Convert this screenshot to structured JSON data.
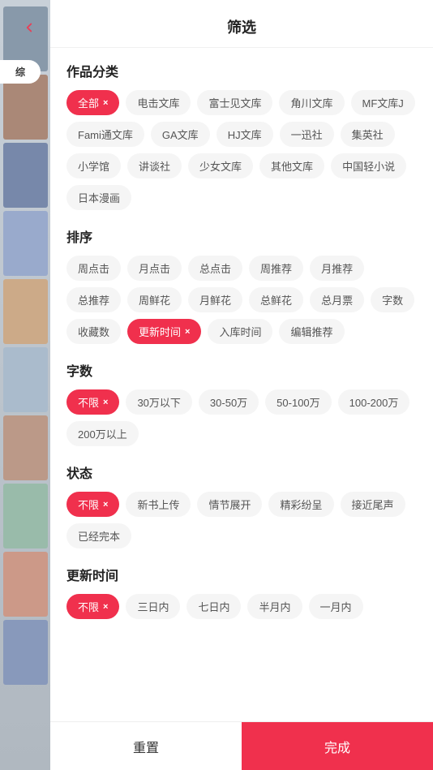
{
  "header": {
    "title": "筛选",
    "back_label": "back"
  },
  "sections": {
    "category": {
      "title": "作品分类",
      "tags": [
        {
          "label": "全部",
          "active": true
        },
        {
          "label": "电击文库",
          "active": false
        },
        {
          "label": "富士见文库",
          "active": false
        },
        {
          "label": "角川文库",
          "active": false
        },
        {
          "label": "MF文库J",
          "active": false
        },
        {
          "label": "Fami通文库",
          "active": false
        },
        {
          "label": "GA文库",
          "active": false
        },
        {
          "label": "HJ文库",
          "active": false
        },
        {
          "label": "一迅社",
          "active": false
        },
        {
          "label": "集英社",
          "active": false
        },
        {
          "label": "小学馆",
          "active": false
        },
        {
          "label": "讲谈社",
          "active": false
        },
        {
          "label": "少女文库",
          "active": false
        },
        {
          "label": "其他文库",
          "active": false
        },
        {
          "label": "中国轻小说",
          "active": false
        },
        {
          "label": "日本漫画",
          "active": false
        }
      ]
    },
    "sort": {
      "title": "排序",
      "tags": [
        {
          "label": "周点击",
          "active": false
        },
        {
          "label": "月点击",
          "active": false
        },
        {
          "label": "总点击",
          "active": false
        },
        {
          "label": "周推荐",
          "active": false
        },
        {
          "label": "月推荐",
          "active": false
        },
        {
          "label": "总推荐",
          "active": false
        },
        {
          "label": "周鲜花",
          "active": false
        },
        {
          "label": "月鲜花",
          "active": false
        },
        {
          "label": "总鲜花",
          "active": false
        },
        {
          "label": "总月票",
          "active": false
        },
        {
          "label": "字数",
          "active": false
        },
        {
          "label": "收藏数",
          "active": false
        },
        {
          "label": "更新时间",
          "active": true
        },
        {
          "label": "入库时间",
          "active": false
        },
        {
          "label": "编辑推荐",
          "active": false
        }
      ]
    },
    "word_count": {
      "title": "字数",
      "tags": [
        {
          "label": "不限",
          "active": true
        },
        {
          "label": "30万以下",
          "active": false
        },
        {
          "label": "30-50万",
          "active": false
        },
        {
          "label": "50-100万",
          "active": false
        },
        {
          "label": "100-200万",
          "active": false
        },
        {
          "label": "200万以上",
          "active": false
        }
      ]
    },
    "status": {
      "title": "状态",
      "tags": [
        {
          "label": "不限",
          "active": true
        },
        {
          "label": "新书上传",
          "active": false
        },
        {
          "label": "情节展开",
          "active": false
        },
        {
          "label": "精彩纷呈",
          "active": false
        },
        {
          "label": "接近尾声",
          "active": false
        },
        {
          "label": "已经完本",
          "active": false
        }
      ]
    },
    "update_time": {
      "title": "更新时间",
      "tags": [
        {
          "label": "不限",
          "active": true
        },
        {
          "label": "三日内",
          "active": false
        },
        {
          "label": "七日内",
          "active": false
        },
        {
          "label": "半月内",
          "active": false
        },
        {
          "label": "一月内",
          "active": false
        }
      ]
    }
  },
  "bottom": {
    "reset_label": "重置",
    "confirm_label": "完成"
  },
  "side": {
    "tab_label": "综"
  },
  "colors": {
    "active": "#f0304d",
    "text_primary": "#222",
    "text_secondary": "#555",
    "bg_tag": "#f5f5f5"
  }
}
